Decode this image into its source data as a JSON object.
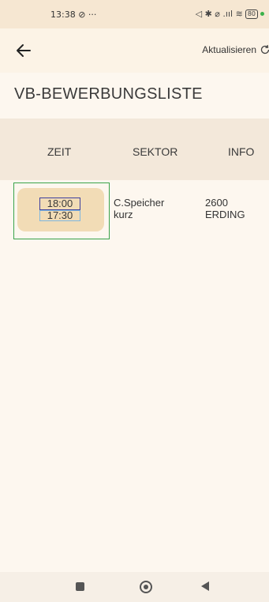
{
  "status_bar": {
    "time": "13:38",
    "extras": "⊘ ···",
    "signals": "◁ ✱ ⌀ .ııl ≋",
    "battery": "80"
  },
  "app_bar": {
    "refresh_label": "Aktualisieren",
    "back_icon": "arrow-left-icon",
    "refresh_icon": "refresh-icon"
  },
  "page": {
    "title": "VB-BEWERBUNGSLISTE"
  },
  "table": {
    "headers": [
      "ZEIT",
      "SEKTOR",
      "INFO"
    ],
    "rows": [
      {
        "time_primary": "18:00",
        "time_secondary": "17:30",
        "sektor_line1": "C.Speicher",
        "sektor_line2": "kurz",
        "info_line1": "2600",
        "info_line2": "ERDING"
      }
    ]
  },
  "colors": {
    "background": "#fdf7ef",
    "header_bg": "#f3e8da",
    "time_pill": "#f2dcb6",
    "highlight_green": "#3aa34a",
    "highlight_blue": "#3d3f9e"
  }
}
